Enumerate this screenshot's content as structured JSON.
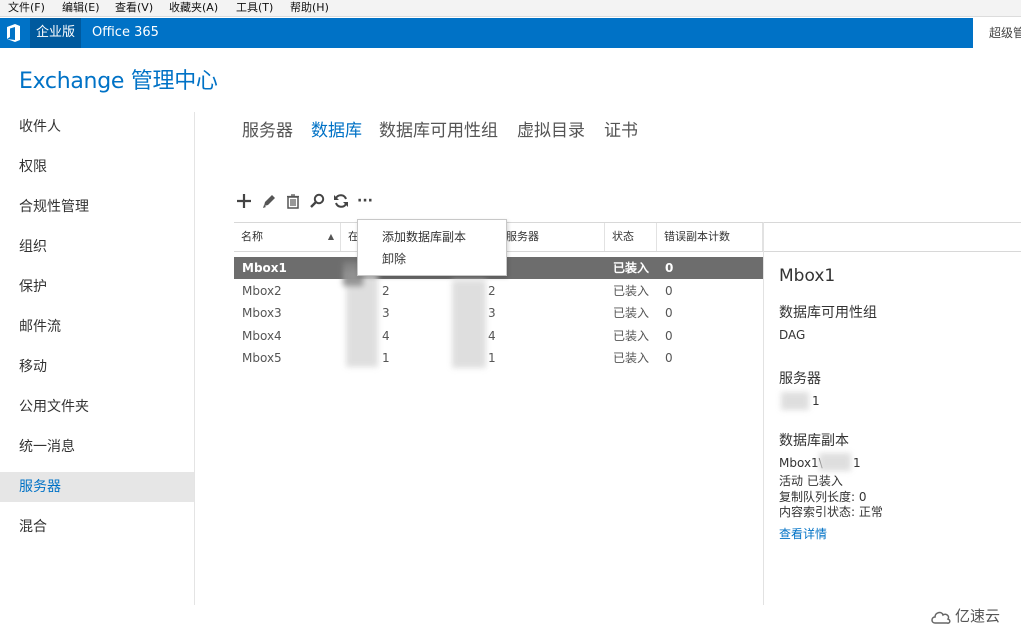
{
  "menubar": {
    "items": [
      "文件(F)",
      "编辑(E)",
      "查看(V)",
      "收藏夹(A)",
      "工具(T)",
      "帮助(H)"
    ]
  },
  "topbar": {
    "edition": "企业版",
    "office365": "Office 365",
    "admin": "超级管"
  },
  "app_title": "Exchange 管理中心",
  "nav": {
    "items": [
      "收件人",
      "权限",
      "合规性管理",
      "组织",
      "保护",
      "邮件流",
      "移动",
      "公用文件夹",
      "统一消息",
      "服务器",
      "混合"
    ],
    "active": "服务器"
  },
  "tabs": {
    "items": [
      "服务器",
      "数据库",
      "数据库可用性组",
      "虚拟目录",
      "证书"
    ],
    "active": "数据库"
  },
  "toolbar": {
    "icons": [
      "add-icon",
      "edit-icon",
      "delete-icon",
      "search-icon",
      "refresh-icon",
      "more-icon"
    ],
    "more": "···"
  },
  "grid": {
    "headers": {
      "name": "名称",
      "mounted_on": "在",
      "servers": "服务器",
      "status": "状态",
      "bad_copy": "错误副本计数"
    },
    "rows": [
      {
        "name": "Mbox1",
        "server": "",
        "server2": "",
        "status": "已装入",
        "errors": "0"
      },
      {
        "name": "Mbox2",
        "server": "2",
        "server2": "2",
        "status": "已装入",
        "errors": "0"
      },
      {
        "name": "Mbox3",
        "server": "3",
        "server2": "3",
        "status": "已装入",
        "errors": "0"
      },
      {
        "name": "Mbox4",
        "server": "4",
        "server2": "4",
        "status": "已装入",
        "errors": "0"
      },
      {
        "name": "Mbox5",
        "server": "1",
        "server2": "1",
        "status": "已装入",
        "errors": "0"
      }
    ],
    "selected": "Mbox1"
  },
  "context_menu": {
    "items": [
      "添加数据库副本",
      "卸除"
    ]
  },
  "details": {
    "title": "Mbox1",
    "dag_heading": "数据库可用性组",
    "dag_value": "DAG",
    "server_heading": "服务器",
    "server_value": "1",
    "copies_heading": "数据库副本",
    "copy_name_prefix": "Mbox1\\",
    "copy_name_suffix": "1",
    "copy_status": "活动 已装入",
    "copy_queue": "复制队列长度: 0",
    "content_index": "内容索引状态: 正常",
    "view_details": "查看详情"
  },
  "watermark": "亿速云",
  "colors": {
    "accent": "#0072c6",
    "selected_row": "#6d6d6d"
  }
}
